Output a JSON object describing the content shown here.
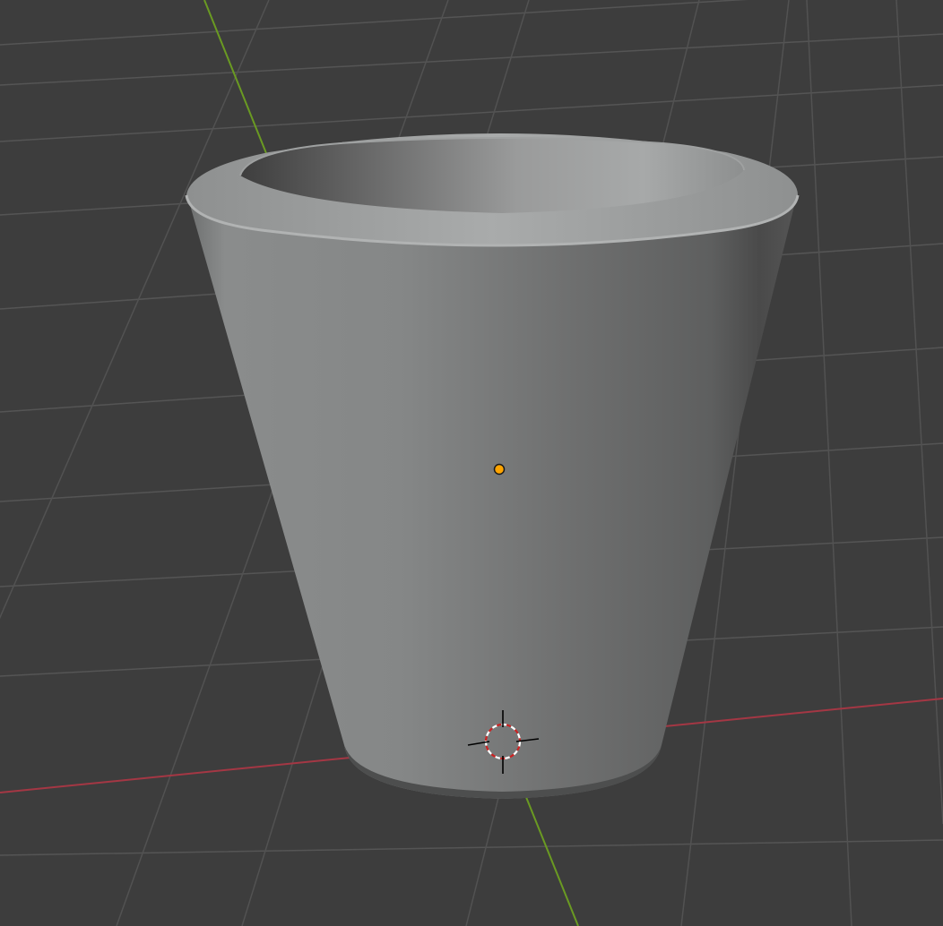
{
  "viewport": {
    "background": "#3d3d3d",
    "grid_color": "#525252",
    "x_axis_color": "#a43744",
    "y_axis_color": "#6a9a22",
    "object_color": "#808282"
  },
  "object": {
    "shape": "tapered cup",
    "origin_color": "#ffa400"
  },
  "cursor_3d": {
    "icon": "3d-cursor-icon",
    "ring_colors": [
      "#ffffff",
      "#cc2222"
    ]
  }
}
